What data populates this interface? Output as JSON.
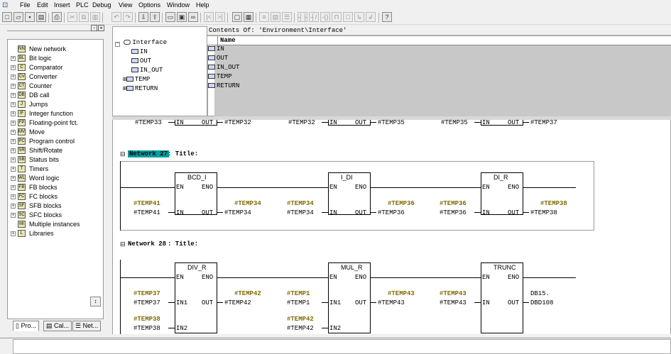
{
  "menu": {
    "items": [
      "File",
      "Edit",
      "Insert",
      "PLC",
      "Debug",
      "View",
      "Options",
      "Window",
      "Help"
    ]
  },
  "toolbar": {
    "icons": [
      "new-icon",
      "open-icon",
      "save-icon",
      "print-icon",
      "cut-icon",
      "copy-icon",
      "paste-icon",
      "undo-icon",
      "redo-icon",
      "download-icon",
      "upload-icon",
      "network-icon",
      "monitor-icon",
      "glasses-icon",
      "overview-icon",
      "details-icon",
      "contact-no-icon",
      "contact-nc-icon",
      "coil-icon",
      "box-icon",
      "branch-open-icon",
      "branch-close-icon",
      "help-icon"
    ]
  },
  "catalog": {
    "items": [
      {
        "label": "New network",
        "expand": false,
        "icon": "NN"
      },
      {
        "label": "Bit logic",
        "expand": true,
        "icon": "BL"
      },
      {
        "label": "Comparator",
        "expand": true,
        "icon": "C"
      },
      {
        "label": "Converter",
        "expand": true,
        "icon": "CV"
      },
      {
        "label": "Counter",
        "expand": true,
        "icon": "CT"
      },
      {
        "label": "DB call",
        "expand": true,
        "icon": "DB"
      },
      {
        "label": "Jumps",
        "expand": true,
        "icon": "J"
      },
      {
        "label": "Integer function",
        "expand": true,
        "icon": "IF"
      },
      {
        "label": "Floating-point fct.",
        "expand": true,
        "icon": "FP"
      },
      {
        "label": "Move",
        "expand": true,
        "icon": "MV"
      },
      {
        "label": "Program control",
        "expand": true,
        "icon": "PC"
      },
      {
        "label": "Shift/Rotate",
        "expand": true,
        "icon": "SR"
      },
      {
        "label": "Status bits",
        "expand": true,
        "icon": "SB"
      },
      {
        "label": "Timers",
        "expand": true,
        "icon": "T"
      },
      {
        "label": "Word logic",
        "expand": true,
        "icon": "WL"
      },
      {
        "label": "FB blocks",
        "expand": true,
        "icon": "FB"
      },
      {
        "label": "FC blocks",
        "expand": true,
        "icon": "FC"
      },
      {
        "label": "SFB blocks",
        "expand": true,
        "icon": "SF"
      },
      {
        "label": "SFC blocks",
        "expand": true,
        "icon": "SC"
      },
      {
        "label": "Multiple instances",
        "expand": false,
        "icon": "MI"
      },
      {
        "label": "Libraries",
        "expand": true,
        "icon": "L"
      }
    ],
    "tabs": [
      "Pro...",
      "Cal...",
      "Net..."
    ]
  },
  "interface": {
    "root": "Interface",
    "items": [
      "IN",
      "OUT",
      "IN_OUT",
      "TEMP",
      "RETURN"
    ]
  },
  "contents": {
    "header": "Contents Of: 'Environment\\Interface'",
    "col_name": "Name",
    "rows": [
      "IN",
      "OUT",
      "IN_OUT",
      "TEMP",
      "RETURN"
    ]
  },
  "top_partial": [
    {
      "in": "#TEMP33",
      "out": "#TEMP32",
      "en_label": "IN",
      "out_label": "OUT"
    },
    {
      "in": "#TEMP32",
      "out": "#TEMP35",
      "en_label": "IN",
      "out_label": "OUT"
    },
    {
      "in": "#TEMP35",
      "out": "#TEMP37",
      "en_label": "IN",
      "out_label": "OUT"
    }
  ],
  "network27": {
    "label": "Network 27",
    "title": ": Title:",
    "blocks": [
      {
        "name": "BCD_I",
        "en": "EN",
        "eno": "ENO",
        "in_pin": "IN",
        "out_pin": "OUT",
        "in_var": "#TEMP41",
        "in_var2": "#TEMP41",
        "out_var": "#TEMP34",
        "out_var2": "#TEMP34"
      },
      {
        "name": "I_DI",
        "en": "EN",
        "eno": "ENO",
        "in_pin": "IN",
        "out_pin": "OUT",
        "in_var": "#TEMP34",
        "in_var2": "#TEMP34",
        "out_var": "#TEMP36",
        "out_var2": "#TEMP36"
      },
      {
        "name": "DI_R",
        "en": "EN",
        "eno": "ENO",
        "in_pin": "IN",
        "out_pin": "OUT",
        "in_var": "#TEMP36",
        "in_var2": "#TEMP36",
        "out_var": "#TEMP38",
        "out_var2": "#TEMP38"
      }
    ]
  },
  "network28": {
    "label": "Network 28",
    "title": ": Title:",
    "blocks": [
      {
        "name": "DIV_R",
        "en": "EN",
        "eno": "ENO",
        "in1": "IN1",
        "in2": "IN2",
        "out_pin": "OUT",
        "in1_var": "#TEMP37",
        "in1_var2": "#TEMP37",
        "in2_var": "#TEMP38",
        "in2_var2": "#TEMP38",
        "out_var": "#TEMP42",
        "out_var2": "#TEMP42"
      },
      {
        "name": "MUL_R",
        "en": "EN",
        "eno": "ENO",
        "in1": "IN1",
        "in2": "IN2",
        "out_pin": "OUT",
        "in1_var": "#TEMP1",
        "in1_var2": "#TEMP1",
        "in2_var": "#TEMP42",
        "in2_var2": "#TEMP42",
        "out_var": "#TEMP43",
        "out_var2": "#TEMP43"
      },
      {
        "name": "TRUNC",
        "en": "EN",
        "eno": "ENO",
        "in_pin": "IN",
        "out_pin": "OUT",
        "in_var": "#TEMP43",
        "in_var2": "#TEMP43",
        "out_var": "DB15.",
        "out_var2": "DBD108"
      }
    ]
  },
  "colors": {
    "olive": "#7f6a00",
    "selection": "#00a0a0",
    "grey_area": "#c8c8c8"
  }
}
